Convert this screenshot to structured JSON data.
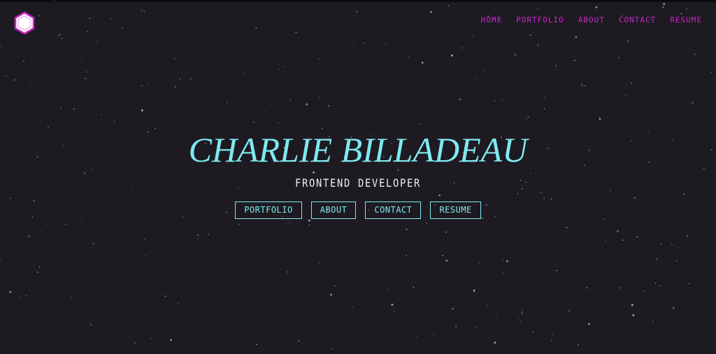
{
  "colors": {
    "background": "#1e1a22",
    "accent_cyan": "#7eeaf0",
    "nav_magenta": "#c926c9",
    "subtitle_white": "#eeeeee"
  },
  "logo": {
    "icon": "hexagon-cube-icon"
  },
  "nav": {
    "items": [
      "HOME",
      "PORTFOLIO",
      "ABOUT",
      "CONTACT",
      "RESUME"
    ]
  },
  "hero": {
    "name": "CHARLIE BILLADEAU",
    "subtitle": "FRONTEND DEVELOPER",
    "buttons": [
      "PORTFOLIO",
      "ABOUT",
      "CONTACT",
      "RESUME"
    ]
  }
}
